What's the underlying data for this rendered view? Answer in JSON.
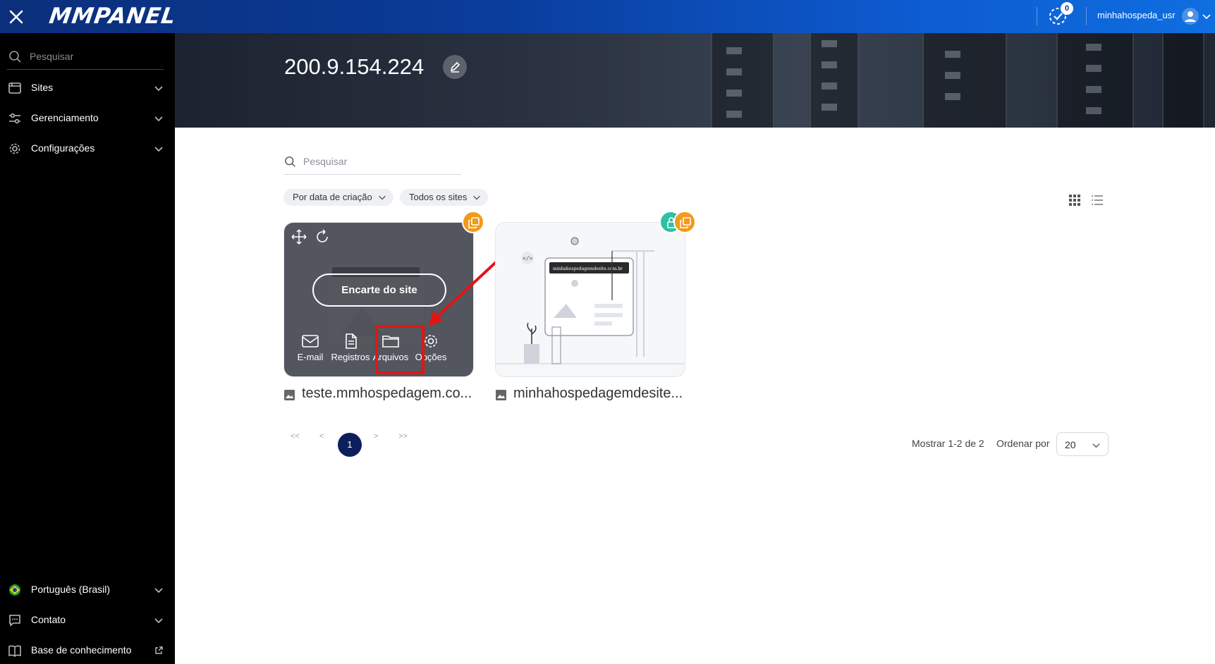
{
  "topbar": {
    "logo": "MMPANEL",
    "tasks_count": "0",
    "username": "minhahospeda_usr"
  },
  "sidebar": {
    "search_placeholder": "Pesquisar",
    "items": [
      {
        "label": "Sites",
        "icon": "browser-window-icon"
      },
      {
        "label": "Gerenciamento",
        "icon": "sliders-icon"
      },
      {
        "label": "Configurações",
        "icon": "gear-icon"
      }
    ],
    "bottom_items": [
      {
        "label": "Português (Brasil)",
        "icon": "brazil-flag-icon"
      },
      {
        "label": "Contato",
        "icon": "chat-icon"
      },
      {
        "label": "Base de conhecimento",
        "icon": "book-icon"
      }
    ]
  },
  "banner": {
    "title": "200.9.154.224"
  },
  "main": {
    "search_placeholder": "Pesquisar",
    "filters": {
      "sort": "Por data de criação",
      "scope": "Todos os sites"
    },
    "cards": [
      {
        "name": "teste.mmhospedagem.co...",
        "primary_action": "Encarte do site",
        "actions": [
          "E-mail",
          "Registros",
          "Arquivos",
          "Opções"
        ]
      },
      {
        "name": "minhahospedagemdesite...",
        "preview_url": "minhahospedagemdesite.com.br"
      }
    ]
  },
  "pagination": {
    "first": "<<",
    "prev": "<",
    "current": "1",
    "next": ">",
    "last": ">>",
    "showing": "Mostrar 1-2 de 2",
    "order_label": "Ordenar por",
    "per_page": "20"
  },
  "colors": {
    "topbar_start": "#0b2f7a",
    "topbar_end": "#0f6ee0",
    "sidebar": "#000000",
    "badge_orange": "#f29a1a",
    "badge_teal": "#2ec0a4",
    "page_current": "#0c1f5c",
    "highlight": "#e31414"
  }
}
